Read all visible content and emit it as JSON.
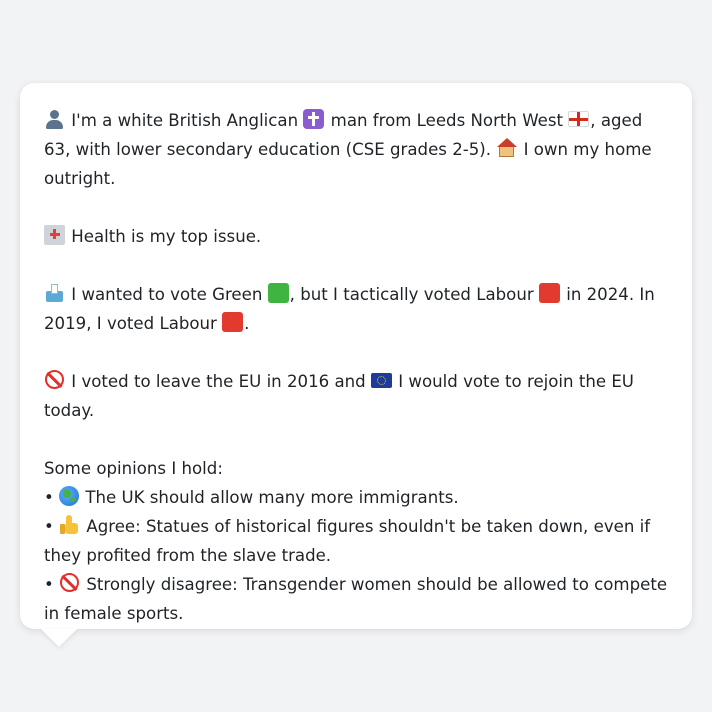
{
  "profile": {
    "p1": {
      "a": " I'm a white British Anglican ",
      "b": " man from Leeds North West ",
      "c": ", aged 63, with lower secondary education (CSE grades 2-5). ",
      "d": " I own my home outright."
    },
    "p2": {
      "a": " Health is my top issue."
    },
    "p3": {
      "a": " I wanted to vote Green ",
      "b": ", but I tactically voted Labour ",
      "c": " in 2024. In 2019, I voted Labour ",
      "d": "."
    },
    "p4": {
      "a": " I voted to leave the EU in 2016 and ",
      "b": " I would vote to rejoin the EU today."
    },
    "opinions": {
      "heading": "Some opinions I hold:",
      "bullet": "•",
      "items": [
        " The UK should allow many more immigrants.",
        " Agree: Statues of historical figures shouldn't be taken down, even if they profited from the slave trade.",
        " Strongly disagree: Transgender women should be allowed to compete in female sports."
      ]
    }
  },
  "icons": {
    "person": "person-icon",
    "cross": "latin-cross-icon",
    "england_flag": "england-flag-icon",
    "house": "house-icon",
    "hospital": "hospital-icon",
    "ballot": "ballot-box-icon",
    "green_square": "green-square-icon",
    "red_square": "red-square-icon",
    "no_entry": "prohibited-icon",
    "eu_flag": "eu-flag-icon",
    "globe": "globe-icon",
    "thumbs_up": "thumbs-up-icon"
  },
  "colors": {
    "background": "#f2f3f5",
    "bubble": "#ffffff",
    "text": "#1f2328",
    "green": "#3fb53f",
    "red": "#e23a2e"
  }
}
